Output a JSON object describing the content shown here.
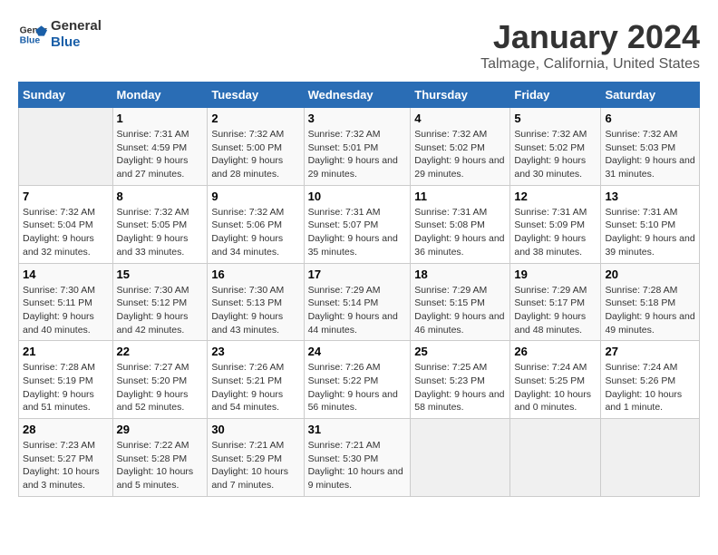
{
  "logo": {
    "line1": "General",
    "line2": "Blue"
  },
  "title": "January 2024",
  "subtitle": "Talmage, California, United States",
  "days_of_week": [
    "Sunday",
    "Monday",
    "Tuesday",
    "Wednesday",
    "Thursday",
    "Friday",
    "Saturday"
  ],
  "weeks": [
    [
      {
        "day": "",
        "sunrise": "",
        "sunset": "",
        "daylight": ""
      },
      {
        "day": "1",
        "sunrise": "Sunrise: 7:31 AM",
        "sunset": "Sunset: 4:59 PM",
        "daylight": "Daylight: 9 hours and 27 minutes."
      },
      {
        "day": "2",
        "sunrise": "Sunrise: 7:32 AM",
        "sunset": "Sunset: 5:00 PM",
        "daylight": "Daylight: 9 hours and 28 minutes."
      },
      {
        "day": "3",
        "sunrise": "Sunrise: 7:32 AM",
        "sunset": "Sunset: 5:01 PM",
        "daylight": "Daylight: 9 hours and 29 minutes."
      },
      {
        "day": "4",
        "sunrise": "Sunrise: 7:32 AM",
        "sunset": "Sunset: 5:02 PM",
        "daylight": "Daylight: 9 hours and 29 minutes."
      },
      {
        "day": "5",
        "sunrise": "Sunrise: 7:32 AM",
        "sunset": "Sunset: 5:02 PM",
        "daylight": "Daylight: 9 hours and 30 minutes."
      },
      {
        "day": "6",
        "sunrise": "Sunrise: 7:32 AM",
        "sunset": "Sunset: 5:03 PM",
        "daylight": "Daylight: 9 hours and 31 minutes."
      }
    ],
    [
      {
        "day": "7",
        "sunrise": "Sunrise: 7:32 AM",
        "sunset": "Sunset: 5:04 PM",
        "daylight": "Daylight: 9 hours and 32 minutes."
      },
      {
        "day": "8",
        "sunrise": "Sunrise: 7:32 AM",
        "sunset": "Sunset: 5:05 PM",
        "daylight": "Daylight: 9 hours and 33 minutes."
      },
      {
        "day": "9",
        "sunrise": "Sunrise: 7:32 AM",
        "sunset": "Sunset: 5:06 PM",
        "daylight": "Daylight: 9 hours and 34 minutes."
      },
      {
        "day": "10",
        "sunrise": "Sunrise: 7:31 AM",
        "sunset": "Sunset: 5:07 PM",
        "daylight": "Daylight: 9 hours and 35 minutes."
      },
      {
        "day": "11",
        "sunrise": "Sunrise: 7:31 AM",
        "sunset": "Sunset: 5:08 PM",
        "daylight": "Daylight: 9 hours and 36 minutes."
      },
      {
        "day": "12",
        "sunrise": "Sunrise: 7:31 AM",
        "sunset": "Sunset: 5:09 PM",
        "daylight": "Daylight: 9 hours and 38 minutes."
      },
      {
        "day": "13",
        "sunrise": "Sunrise: 7:31 AM",
        "sunset": "Sunset: 5:10 PM",
        "daylight": "Daylight: 9 hours and 39 minutes."
      }
    ],
    [
      {
        "day": "14",
        "sunrise": "Sunrise: 7:30 AM",
        "sunset": "Sunset: 5:11 PM",
        "daylight": "Daylight: 9 hours and 40 minutes."
      },
      {
        "day": "15",
        "sunrise": "Sunrise: 7:30 AM",
        "sunset": "Sunset: 5:12 PM",
        "daylight": "Daylight: 9 hours and 42 minutes."
      },
      {
        "day": "16",
        "sunrise": "Sunrise: 7:30 AM",
        "sunset": "Sunset: 5:13 PM",
        "daylight": "Daylight: 9 hours and 43 minutes."
      },
      {
        "day": "17",
        "sunrise": "Sunrise: 7:29 AM",
        "sunset": "Sunset: 5:14 PM",
        "daylight": "Daylight: 9 hours and 44 minutes."
      },
      {
        "day": "18",
        "sunrise": "Sunrise: 7:29 AM",
        "sunset": "Sunset: 5:15 PM",
        "daylight": "Daylight: 9 hours and 46 minutes."
      },
      {
        "day": "19",
        "sunrise": "Sunrise: 7:29 AM",
        "sunset": "Sunset: 5:17 PM",
        "daylight": "Daylight: 9 hours and 48 minutes."
      },
      {
        "day": "20",
        "sunrise": "Sunrise: 7:28 AM",
        "sunset": "Sunset: 5:18 PM",
        "daylight": "Daylight: 9 hours and 49 minutes."
      }
    ],
    [
      {
        "day": "21",
        "sunrise": "Sunrise: 7:28 AM",
        "sunset": "Sunset: 5:19 PM",
        "daylight": "Daylight: 9 hours and 51 minutes."
      },
      {
        "day": "22",
        "sunrise": "Sunrise: 7:27 AM",
        "sunset": "Sunset: 5:20 PM",
        "daylight": "Daylight: 9 hours and 52 minutes."
      },
      {
        "day": "23",
        "sunrise": "Sunrise: 7:26 AM",
        "sunset": "Sunset: 5:21 PM",
        "daylight": "Daylight: 9 hours and 54 minutes."
      },
      {
        "day": "24",
        "sunrise": "Sunrise: 7:26 AM",
        "sunset": "Sunset: 5:22 PM",
        "daylight": "Daylight: 9 hours and 56 minutes."
      },
      {
        "day": "25",
        "sunrise": "Sunrise: 7:25 AM",
        "sunset": "Sunset: 5:23 PM",
        "daylight": "Daylight: 9 hours and 58 minutes."
      },
      {
        "day": "26",
        "sunrise": "Sunrise: 7:24 AM",
        "sunset": "Sunset: 5:25 PM",
        "daylight": "Daylight: 10 hours and 0 minutes."
      },
      {
        "day": "27",
        "sunrise": "Sunrise: 7:24 AM",
        "sunset": "Sunset: 5:26 PM",
        "daylight": "Daylight: 10 hours and 1 minute."
      }
    ],
    [
      {
        "day": "28",
        "sunrise": "Sunrise: 7:23 AM",
        "sunset": "Sunset: 5:27 PM",
        "daylight": "Daylight: 10 hours and 3 minutes."
      },
      {
        "day": "29",
        "sunrise": "Sunrise: 7:22 AM",
        "sunset": "Sunset: 5:28 PM",
        "daylight": "Daylight: 10 hours and 5 minutes."
      },
      {
        "day": "30",
        "sunrise": "Sunrise: 7:21 AM",
        "sunset": "Sunset: 5:29 PM",
        "daylight": "Daylight: 10 hours and 7 minutes."
      },
      {
        "day": "31",
        "sunrise": "Sunrise: 7:21 AM",
        "sunset": "Sunset: 5:30 PM",
        "daylight": "Daylight: 10 hours and 9 minutes."
      },
      {
        "day": "",
        "sunrise": "",
        "sunset": "",
        "daylight": ""
      },
      {
        "day": "",
        "sunrise": "",
        "sunset": "",
        "daylight": ""
      },
      {
        "day": "",
        "sunrise": "",
        "sunset": "",
        "daylight": ""
      }
    ]
  ]
}
